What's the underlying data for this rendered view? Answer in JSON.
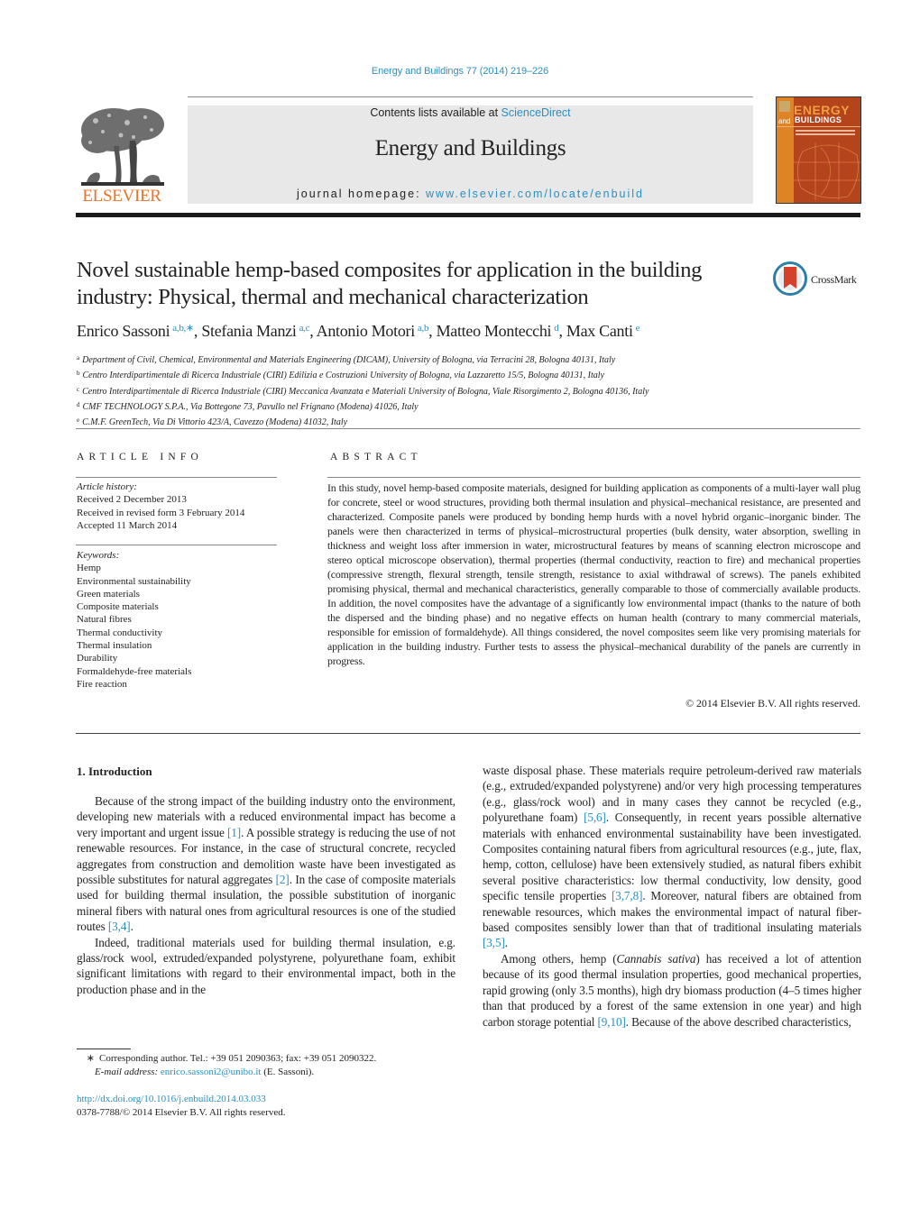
{
  "header": {
    "citation": "Energy and Buildings 77 (2014) 219–226",
    "contents_prefix": "Contents lists available at ",
    "contents_link": "ScienceDirect",
    "journal_name": "Energy and Buildings",
    "homepage_prefix": "journal homepage: ",
    "homepage_link": "www.elsevier.com/locate/enbuild",
    "publisher_wordmark": "ELSEVIER",
    "cover": {
      "title_line1": "ENERGY",
      "title_and": "and",
      "title_line2": "BUILDINGS"
    },
    "colors": {
      "link": "#2b8fc1",
      "elsevier_orange": "#e8732a",
      "banner_gray": "#e8e8e8",
      "cover_brown": "#b4441c",
      "cover_orange": "#de8425"
    }
  },
  "article": {
    "title": "Novel sustainable hemp-based composites for application in the building industry: Physical, thermal and mechanical characterization",
    "crossmark_label": "CrossMark",
    "authors": [
      {
        "name": "Enrico Sassoni",
        "sup": "a,b,∗",
        "sep": ", "
      },
      {
        "name": "Stefania Manzi",
        "sup": "a,c",
        "sep": ", "
      },
      {
        "name": "Antonio Motori",
        "sup": "a,b",
        "sep": ", "
      },
      {
        "name": "Matteo Montecchi",
        "sup": "d",
        "sep": ", "
      },
      {
        "name": "Max Canti",
        "sup": "e",
        "sep": ""
      }
    ],
    "affiliations": [
      {
        "key": "a",
        "text": "Department of Civil, Chemical, Environmental and Materials Engineering (DICAM), University of Bologna, via Terracini 28, Bologna 40131, Italy"
      },
      {
        "key": "b",
        "text": "Centro Interdipartimentale di Ricerca Industriale (CIRI) Edilizia e Costruzioni University of Bologna, via Lazzaretto 15/5, Bologna 40131, Italy"
      },
      {
        "key": "c",
        "text": "Centro Interdipartimentale di Ricerca Industriale (CIRI) Meccanica Avanzata e Materiali University of Bologna, Viale Risorgimento 2, Bologna 40136, Italy"
      },
      {
        "key": "d",
        "text": "CMF TECHNOLOGY S.P.A., Via Bottegone 73, Pavullo nel Frignano (Modena) 41026, Italy"
      },
      {
        "key": "e",
        "text": "C.M.F. GreenTech, Via Di Vittorio 423/A, Cavezzo (Modena) 41032, Italy"
      }
    ]
  },
  "article_info": {
    "heading": "ARTICLE INFO",
    "history_heading": "Article history:",
    "history": [
      "Received 2 December 2013",
      "Received in revised form 3 February 2014",
      "Accepted 11 March 2014"
    ],
    "keywords_heading": "Keywords:",
    "keywords": [
      "Hemp",
      "Environmental sustainability",
      "Green materials",
      "Composite materials",
      "Natural fibres",
      "Thermal conductivity",
      "Thermal insulation",
      "Durability",
      "Formaldehyde-free materials",
      "Fire reaction"
    ]
  },
  "abstract": {
    "heading": "ABSTRACT",
    "text": "In this study, novel hemp-based composite materials, designed for building application as components of a multi-layer wall plug for concrete, steel or wood structures, providing both thermal insulation and physical–mechanical resistance, are presented and characterized. Composite panels were produced by bonding hemp hurds with a novel hybrid organic–inorganic binder. The panels were then characterized in terms of physical–microstructural properties (bulk density, water absorption, swelling in thickness and weight loss after immersion in water, microstructural features by means of scanning electron microscope and stereo optical microscope observation), thermal properties (thermal conductivity, reaction to fire) and mechanical properties (compressive strength, flexural strength, tensile strength, resistance to axial withdrawal of screws). The panels exhibited promising physical, thermal and mechanical characteristics, generally comparable to those of commercially available products. In addition, the novel composites have the advantage of a significantly low environmental impact (thanks to the nature of both the dispersed and the binding phase) and no negative effects on human health (contrary to many commercial materials, responsible for emission of formaldehyde). All things considered, the novel composites seem like very promising materials for application in the building industry. Further tests to assess the physical–mechanical durability of the panels are currently in progress.",
    "copyright": "© 2014 Elsevier B.V. All rights reserved."
  },
  "introduction": {
    "heading": "1.  Introduction",
    "left": {
      "p1_a": "Because of the strong impact of the building industry onto the environment, developing new materials with a reduced environmental impact has become a very important and urgent issue ",
      "p1_ref1": "[1]",
      "p1_b": ". A possible strategy is reducing the use of not renewable resources. For instance, in the case of structural concrete, recycled aggregates from construction and demolition waste have been investigated as possible substitutes for natural aggregates ",
      "p1_ref2": "[2]",
      "p1_c": ". In the case of composite materials used for building thermal insulation, the possible substitution of inorganic mineral fibers with natural ones from agricultural resources is one of the studied routes ",
      "p1_ref3": "[3,4]",
      "p1_d": ".",
      "p2": "Indeed, traditional materials used for building thermal insulation, e.g. glass/rock wool, extruded/expanded polystyrene, polyurethane foam, exhibit significant limitations with regard to their environmental impact, both in the production phase and in the"
    },
    "right": {
      "p1_a": "waste disposal phase. These materials require petroleum-derived raw materials (e.g., extruded/expanded polystyrene) and/or very high processing temperatures (e.g., glass/rock wool) and in many cases they cannot be recycled (e.g., polyurethane foam) ",
      "p1_ref1": "[5,6]",
      "p1_b": ". Consequently, in recent years possible alternative materials with enhanced environmental sustainability have been investigated. Composites containing natural fibers from agricultural resources (e.g., jute, flax, hemp, cotton, cellulose) have been extensively studied, as natural fibers exhibit several positive characteristics: low thermal conductivity, low density, good specific tensile properties ",
      "p1_ref2": "[3,7,8]",
      "p1_c": ". Moreover, natural fibers are obtained from renewable resources, which makes the environmental impact of natural fiber-based composites sensibly lower than that of traditional insulating materials ",
      "p1_ref3": "[3,5]",
      "p1_d": ".",
      "p2_a": "Among others, hemp (",
      "p2_italic": "Cannabis sativa",
      "p2_b": ") has received a lot of attention because of its good thermal insulation properties, good mechanical properties, rapid growing (only 3.5 months), high dry biomass production (4–5 times higher than that produced by a forest of the same extension in one year) and high carbon storage potential ",
      "p2_ref": "[9,10]",
      "p2_c": ". Because of the above described characteristics,"
    }
  },
  "footnote": {
    "marker": "∗",
    "text": "Corresponding author. Tel.: +39 051 2090363; fax: +39 051 2090322.",
    "email_label": "E-mail address:",
    "email": "enrico.sassoni2@unibo.it",
    "email_suffix": " (E. Sassoni)."
  },
  "doi": {
    "link": "http://dx.doi.org/10.1016/j.enbuild.2014.03.033",
    "issn_line": "0378-7788/© 2014 Elsevier B.V. All rights reserved."
  }
}
